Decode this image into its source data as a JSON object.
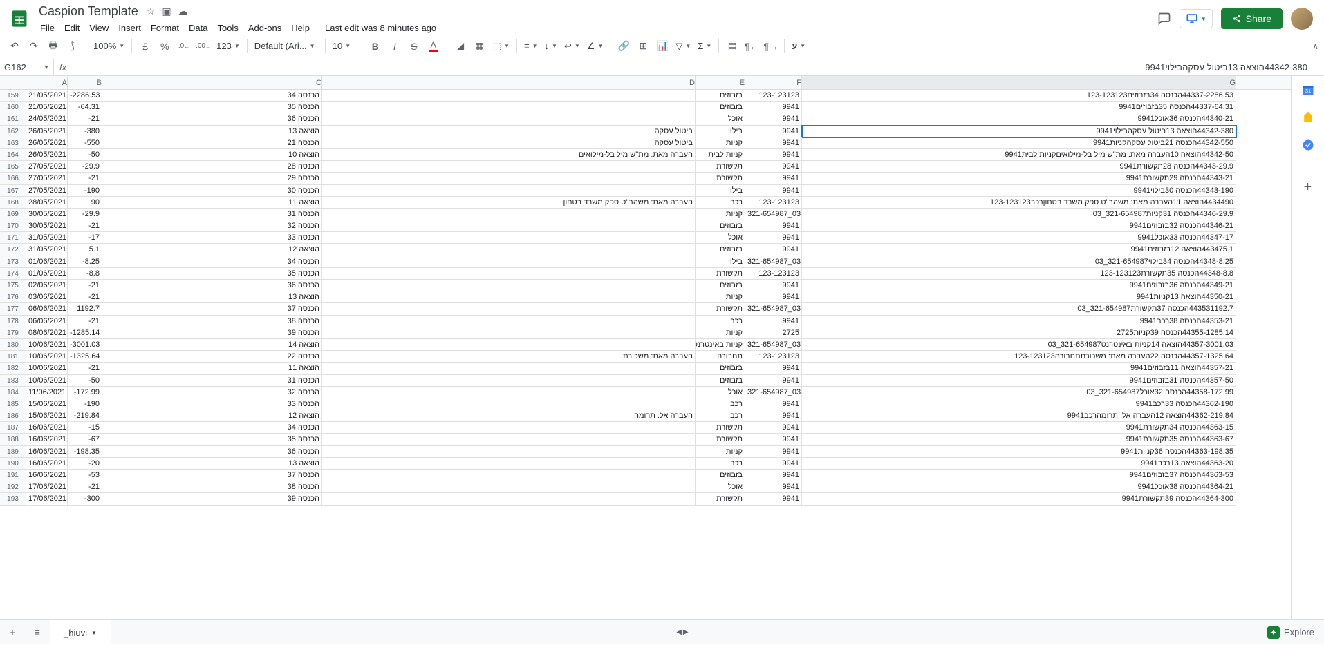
{
  "header": {
    "title": "Caspion Template",
    "last_edit": "Last edit was 8 minutes ago",
    "share": "Share"
  },
  "menu": {
    "file": "File",
    "edit": "Edit",
    "view": "View",
    "insert": "Insert",
    "format": "Format",
    "data": "Data",
    "tools": "Tools",
    "addons": "Add-ons",
    "help": "Help"
  },
  "toolbar": {
    "zoom": "100%",
    "currency": "£",
    "percent": "%",
    "dec_dec": ".0",
    "dec_inc": ".00",
    "num_fmt": "123",
    "font": "Default (Ari...",
    "size": "10",
    "rtl": "ע"
  },
  "formula": {
    "cell": "G162",
    "value": "44342-380הוצאה 13ביטול עסקהבילוי9941"
  },
  "columns": [
    "A",
    "B",
    "C",
    "D",
    "E",
    "F",
    "G"
  ],
  "sheet_tab": "_hiuvi",
  "explore": "Explore",
  "rows": [
    {
      "n": 159,
      "a": "21/05/2021",
      "b": "-2286.53",
      "c": "הכנסה 34",
      "d": "",
      "e": "בזבוזים",
      "f": "123-123123",
      "g": "44337-2286.53הכנסה 34בזבוזים123-123123"
    },
    {
      "n": 160,
      "a": "21/05/2021",
      "b": "-64.31",
      "c": "הכנסה 35",
      "d": "",
      "e": "בזבוזים",
      "f": "9941",
      "g": "44337-64.31הכנסה 35בזבוזים9941"
    },
    {
      "n": 161,
      "a": "24/05/2021",
      "b": "-21",
      "c": "הכנסה 36",
      "d": "",
      "e": "אוכל",
      "f": "9941",
      "g": "44340-21הכנסה 36אוכל9941"
    },
    {
      "n": 162,
      "a": "26/05/2021",
      "b": "-380",
      "c": "הוצאה 13",
      "d": "ביטול עסקה",
      "e": "בילוי",
      "f": "9941",
      "g": "44342-380הוצאה 13ביטול עסקהבילוי9941",
      "sel": true
    },
    {
      "n": 163,
      "a": "26/05/2021",
      "b": "-550",
      "c": "הכנסה 21",
      "d": "ביטול עסקה",
      "e": "קניות",
      "f": "9941",
      "g": "44342-550הכנסה 21ביטול עסקהקניות9941"
    },
    {
      "n": 164,
      "a": "26/05/2021",
      "b": "-50",
      "c": "הוצאה 10",
      "d": "העברה מאת: מת\"ש מיל בל-מילואים",
      "e": "קניות לבית",
      "f": "9941",
      "g": "44342-50הוצאה 10העברה מאת: מת\"ש מיל בל-מילואיםקניות לבית9941"
    },
    {
      "n": 165,
      "a": "27/05/2021",
      "b": "-29.9",
      "c": "הכנסה 28",
      "d": "",
      "e": "תקשורת",
      "f": "9941",
      "g": "44343-29.9הכנסה 28תקשורת9941"
    },
    {
      "n": 166,
      "a": "27/05/2021",
      "b": "-21",
      "c": "הכנסה 29",
      "d": "",
      "e": "תקשורת",
      "f": "9941",
      "g": "44343-21הכנסה 29תקשורת9941"
    },
    {
      "n": 167,
      "a": "27/05/2021",
      "b": "-190",
      "c": "הכנסה 30",
      "d": "",
      "e": "בילוי",
      "f": "9941",
      "g": "44343-190הכנסה 30בילוי9941"
    },
    {
      "n": 168,
      "a": "28/05/2021",
      "b": "90",
      "c": "הוצאה 11",
      "d": "העברה מאת: משהב\"ט ספק משרד בטחון",
      "e": "רכב",
      "f": "123-123123",
      "g": "4434490הוצאה 11העברה מאת: משהב\"ט ספק משרד בטחוןרכב123-123123"
    },
    {
      "n": 169,
      "a": "30/05/2021",
      "b": "-29.9",
      "c": "הכנסה 31",
      "d": "",
      "e": "קניות",
      "f": "321-654987_03",
      "g": "44346-29.9הכנסה 31קניות321-654987_03"
    },
    {
      "n": 170,
      "a": "30/05/2021",
      "b": "-21",
      "c": "הכנסה 32",
      "d": "",
      "e": "בזבוזים",
      "f": "9941",
      "g": "44346-21הכנסה 32בזבוזים9941"
    },
    {
      "n": 171,
      "a": "31/05/2021",
      "b": "-17",
      "c": "הכנסה 33",
      "d": "",
      "e": "אוכל",
      "f": "9941",
      "g": "44347-17הכנסה 33אוכל9941"
    },
    {
      "n": 172,
      "a": "31/05/2021",
      "b": "5.1",
      "c": "הוצאה 12",
      "d": "",
      "e": "בזבוזים",
      "f": "9941",
      "g": "443475.1הוצאה 12בזבוזים9941"
    },
    {
      "n": 173,
      "a": "01/06/2021",
      "b": "-8.25",
      "c": "הכנסה 34",
      "d": "",
      "e": "בילוי",
      "f": "321-654987_03",
      "g": "44348-8.25הכנסה 34בילוי321-654987_03"
    },
    {
      "n": 174,
      "a": "01/06/2021",
      "b": "-8.8",
      "c": "הכנסה 35",
      "d": "",
      "e": "תקשורת",
      "f": "123-123123",
      "g": "44348-8.8הכנסה 35תקשורת123-123123"
    },
    {
      "n": 175,
      "a": "02/06/2021",
      "b": "-21",
      "c": "הכנסה 36",
      "d": "",
      "e": "בזבוזים",
      "f": "9941",
      "g": "44349-21הכנסה 36בזבוזים9941"
    },
    {
      "n": 176,
      "a": "03/06/2021",
      "b": "-21",
      "c": "הוצאה 13",
      "d": "",
      "e": "קניות",
      "f": "9941",
      "g": "44350-21הוצאה 13קניות9941"
    },
    {
      "n": 177,
      "a": "06/06/2021",
      "b": "1192.7",
      "c": "הכנסה 37",
      "d": "",
      "e": "תקשורת",
      "f": "321-654987_03",
      "g": "443531192.7הכנסה 37תקשורת321-654987_03"
    },
    {
      "n": 178,
      "a": "06/06/2021",
      "b": "-21",
      "c": "הכנסה 38",
      "d": "",
      "e": "רכב",
      "f": "9941",
      "g": "44353-21הכנסה 38רכב9941"
    },
    {
      "n": 179,
      "a": "08/06/2021",
      "b": "-1285.14",
      "c": "הכנסה 39",
      "d": "",
      "e": "קניות",
      "f": "2725",
      "g": "44355-1285.14הכנסה 39קניות2725"
    },
    {
      "n": 180,
      "a": "10/06/2021",
      "b": "-3001.03",
      "c": "הוצאה 14",
      "d": "",
      "e": "קניות באינטרנט",
      "f": "321-654987_03",
      "g": "44357-3001.03הוצאה 14קניות באינטרנט321-654987_03"
    },
    {
      "n": 181,
      "a": "10/06/2021",
      "b": "-1325.64",
      "c": "הכנסה 22",
      "d": "העברה מאת: משכורת",
      "e": "תחבורה",
      "f": "123-123123",
      "g": "44357-1325.64הכנסה 22העברה מאת: משכורתתחבורה123-123123"
    },
    {
      "n": 182,
      "a": "10/06/2021",
      "b": "-21",
      "c": "הוצאה 11",
      "d": "",
      "e": "בזבוזים",
      "f": "9941",
      "g": "44357-21הוצאה 11בזבוזים9941"
    },
    {
      "n": 183,
      "a": "10/06/2021",
      "b": "-50",
      "c": "הכנסה 31",
      "d": "",
      "e": "בזבוזים",
      "f": "9941",
      "g": "44357-50הכנסה 31בזבוזים9941"
    },
    {
      "n": 184,
      "a": "11/06/2021",
      "b": "-172.99",
      "c": "הכנסה 32",
      "d": "",
      "e": "אוכל",
      "f": "321-654987_03",
      "g": "44358-172.99הכנסה 32אוכל321-654987_03"
    },
    {
      "n": 185,
      "a": "15/06/2021",
      "b": "-190",
      "c": "הכנסה 33",
      "d": "",
      "e": "רכב",
      "f": "9941",
      "g": "44362-190הכנסה 33רכב9941"
    },
    {
      "n": 186,
      "a": "15/06/2021",
      "b": "-219.84",
      "c": "הוצאה 12",
      "d": "העברה אל: תרומה",
      "e": "רכב",
      "f": "9941",
      "g": "44362-219.84הוצאה 12העברה אל: תרומהרכב9941"
    },
    {
      "n": 187,
      "a": "16/06/2021",
      "b": "-15",
      "c": "הכנסה 34",
      "d": "",
      "e": "תקשורת",
      "f": "9941",
      "g": "44363-15הכנסה 34תקשורת9941"
    },
    {
      "n": 188,
      "a": "16/06/2021",
      "b": "-67",
      "c": "הכנסה 35",
      "d": "",
      "e": "תקשורת",
      "f": "9941",
      "g": "44363-67הכנסה 35תקשורת9941"
    },
    {
      "n": 189,
      "a": "16/06/2021",
      "b": "-198.35",
      "c": "הכנסה 36",
      "d": "",
      "e": "קניות",
      "f": "9941",
      "g": "44363-198.35הכנסה 36קניות9941"
    },
    {
      "n": 190,
      "a": "16/06/2021",
      "b": "-20",
      "c": "הוצאה 13",
      "d": "",
      "e": "רכב",
      "f": "9941",
      "g": "44363-20הוצאה 13רכב9941"
    },
    {
      "n": 191,
      "a": "16/06/2021",
      "b": "-53",
      "c": "הכנסה 37",
      "d": "",
      "e": "בזבוזים",
      "f": "9941",
      "g": "44363-53הכנסה 37בזבוזים9941"
    },
    {
      "n": 192,
      "a": "17/06/2021",
      "b": "-21",
      "c": "הכנסה 38",
      "d": "",
      "e": "אוכל",
      "f": "9941",
      "g": "44364-21הכנסה 38אוכל9941"
    },
    {
      "n": 193,
      "a": "17/06/2021",
      "b": "-300",
      "c": "הכנסה 39",
      "d": "",
      "e": "תקשורת",
      "f": "9941",
      "g": "44364-300הכנסה 39תקשורת9941"
    }
  ]
}
